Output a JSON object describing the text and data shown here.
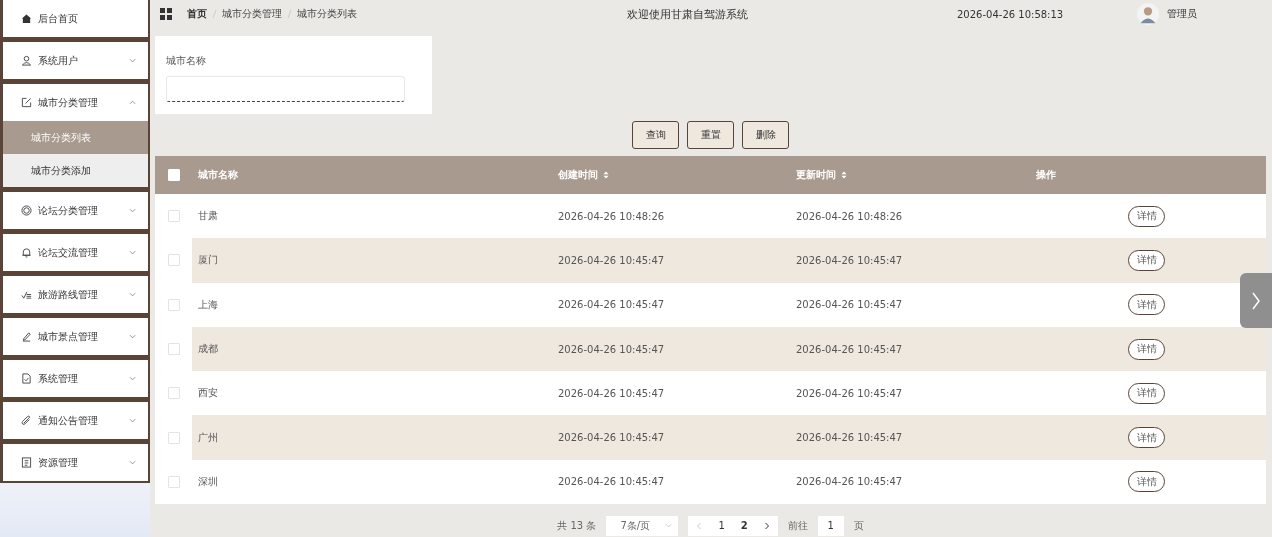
{
  "sidebar": {
    "items": [
      {
        "label": "后台首页"
      },
      {
        "label": "系统用户",
        "expanded": false
      },
      {
        "label": "城市分类管理",
        "expanded": true,
        "children": [
          {
            "label": "城市分类列表",
            "selected": true
          },
          {
            "label": "城市分类添加",
            "selected": false
          }
        ]
      },
      {
        "label": "论坛分类管理",
        "expanded": false
      },
      {
        "label": "论坛交流管理",
        "expanded": false
      },
      {
        "label": "旅游路线管理",
        "expanded": false
      },
      {
        "label": "城市景点管理",
        "expanded": false
      },
      {
        "label": "系统管理",
        "expanded": false
      },
      {
        "label": "通知公告管理",
        "expanded": false
      },
      {
        "label": "资源管理",
        "expanded": false
      }
    ]
  },
  "header": {
    "breadcrumb": [
      "首页",
      "城市分类管理",
      "城市分类列表"
    ],
    "title": "欢迎使用甘肃自驾游系统",
    "datetime": "2026-04-26 10:58:13",
    "user": "管理员"
  },
  "search": {
    "label": "城市名称"
  },
  "buttons": [
    "查询",
    "重置",
    "删除"
  ],
  "table": {
    "all_checked": false,
    "columns": [
      {
        "label": "城市名称",
        "sortable": false
      },
      {
        "label": "创建时间",
        "sortable": true
      },
      {
        "label": "更新时间",
        "sortable": true
      },
      {
        "label": "操作",
        "sortable": false
      }
    ],
    "rows": [
      {
        "checked": false,
        "city": "甘肃",
        "created": "2026-04-26 10:48:26",
        "updated": "2026-04-26 10:48:26",
        "action": "详情"
      },
      {
        "checked": false,
        "city": "厦门",
        "created": "2026-04-26 10:45:47",
        "updated": "2026-04-26 10:45:47",
        "action": "详情"
      },
      {
        "checked": false,
        "city": "上海",
        "created": "2026-04-26 10:45:47",
        "updated": "2026-04-26 10:45:47",
        "action": "详情"
      },
      {
        "checked": false,
        "city": "成都",
        "created": "2026-04-26 10:45:47",
        "updated": "2026-04-26 10:45:47",
        "action": "详情"
      },
      {
        "checked": false,
        "city": "西安",
        "created": "2026-04-26 10:45:47",
        "updated": "2026-04-26 10:45:47",
        "action": "详情"
      },
      {
        "checked": false,
        "city": "广州",
        "created": "2026-04-26 10:45:47",
        "updated": "2026-04-26 10:45:47",
        "action": "详情"
      },
      {
        "checked": false,
        "city": "深圳",
        "created": "2026-04-26 10:45:47",
        "updated": "2026-04-26 10:45:47",
        "action": "详情"
      }
    ]
  },
  "pagination": {
    "total": "共 13 条",
    "page_size": "7条/页",
    "pages": [
      {
        "label": "1",
        "selected": false
      },
      {
        "label": "2",
        "selected": true
      }
    ],
    "goto_label": "前往",
    "goto_value": "1",
    "goto_unit": "页"
  }
}
